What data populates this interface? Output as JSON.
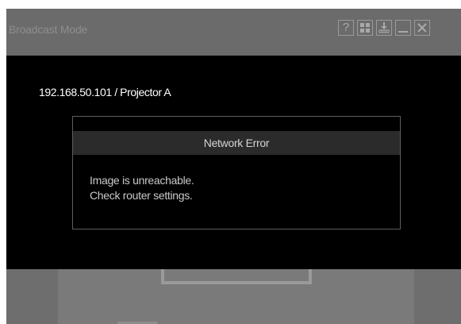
{
  "window": {
    "title": "Broadcast Mode",
    "controls": {
      "help_label": "?",
      "help_icon": "question-icon",
      "grid_icon": "grid-icon",
      "download_icon": "download-icon",
      "minimize_icon": "minimize-icon",
      "close_icon": "close-icon"
    }
  },
  "device": {
    "label": "192.168.50.101 / Projector A"
  },
  "error_dialog": {
    "title": "Network Error",
    "message_line1": "Image is unreachable.",
    "message_line2": "Check router settings."
  },
  "colors": {
    "title_bar": "#6b6b6b",
    "main_panel": "#000000",
    "dialog_header": "#2b2b2b",
    "bottom_area": "#6e6e6e"
  }
}
